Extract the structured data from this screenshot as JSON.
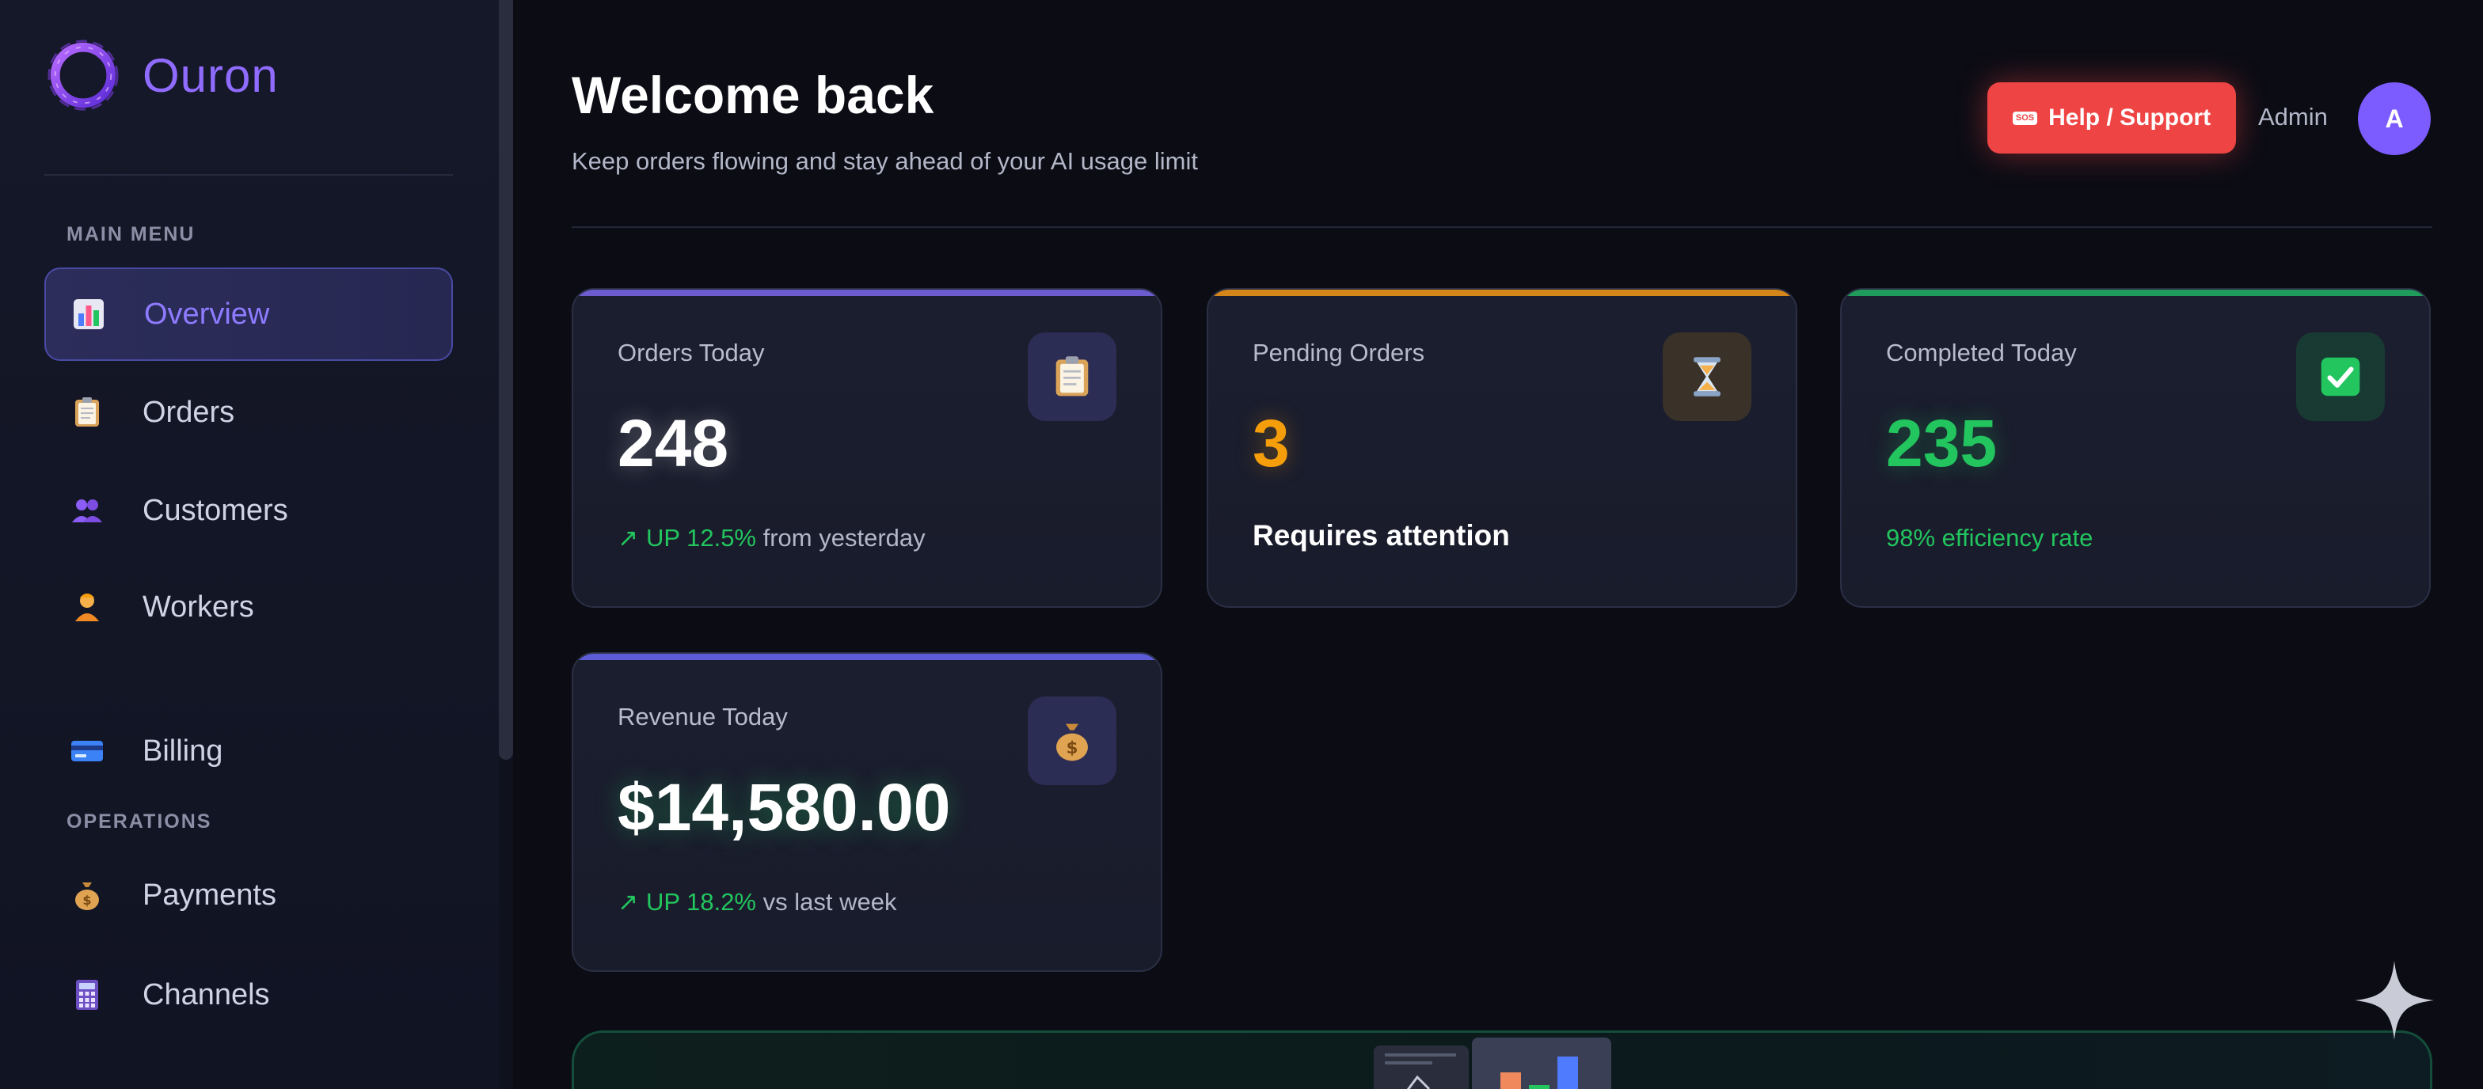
{
  "brand": {
    "name": "Ouron"
  },
  "sidebar": {
    "sections": {
      "main_menu": "MAIN MENU",
      "operations": "OPERATIONS"
    },
    "items": [
      {
        "label": "Overview",
        "icon": "bar-chart-icon",
        "active": true
      },
      {
        "label": "Orders",
        "icon": "clipboard-icon"
      },
      {
        "label": "Customers",
        "icon": "people-icon"
      },
      {
        "label": "Workers",
        "icon": "worker-icon"
      },
      {
        "label": "Billing",
        "icon": "credit-card-icon"
      },
      {
        "label": "Payments",
        "icon": "money-bag-icon"
      },
      {
        "label": "Channels",
        "icon": "abacus-icon"
      }
    ]
  },
  "header": {
    "title": "Welcome back",
    "subtitle": "Keep orders flowing and stay ahead of your AI usage limit",
    "help_label": "Help / Support",
    "help_badge": "SOS",
    "user_name": "Admin",
    "avatar_initial": "A"
  },
  "cards": [
    {
      "label": "Orders Today",
      "value": "248",
      "trend": "UP 12.5%",
      "trend_suffix": " from yesterday",
      "icon": "clipboard-icon",
      "accent": "#6d5bd0"
    },
    {
      "label": "Pending Orders",
      "value": "3",
      "note": "Requires attention",
      "icon": "hourglass-icon",
      "accent": "#d4861a",
      "value_color": "#f59e0b"
    },
    {
      "label": "Completed Today",
      "value": "235",
      "note": "98% efficiency rate",
      "icon": "check-icon",
      "accent": "#1f9c5b",
      "value_color": "#22c55e"
    },
    {
      "label": "Revenue Today",
      "value": "$14,580.00",
      "trend": "UP 18.2%",
      "trend_suffix": " vs last week",
      "icon": "money-bag-icon",
      "accent": "#5b5cd6"
    }
  ],
  "colors": {
    "accent": "#8f6bff",
    "danger": "#ef4444",
    "success": "#22c55e",
    "warning": "#f59e0b"
  }
}
